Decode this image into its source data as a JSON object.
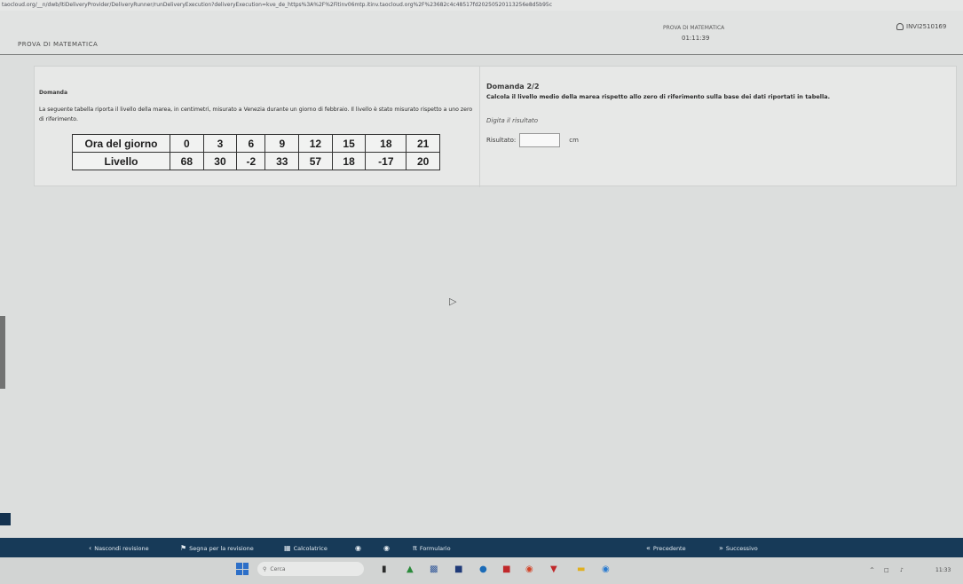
{
  "browser": {
    "url": "taocloud.org/__n/dwb/ltiDeliveryProvider/DeliveryRunner/runDeliveryExecution?deliveryExecution=kve_de_https%3A%2F%2Fitinv06mtp.itinv.taocloud.org%2F%23682c4c48517fd20250520113256e8d5b95c"
  },
  "header": {
    "app_name": "PROVA DI MATEMATICA",
    "exam_title": "PROVA DI MATEMATICA",
    "timer": "01:11:39",
    "user_id": "INVI2510169"
  },
  "question": {
    "heading": "Domanda",
    "text": "La seguente tabella riporta il livello della marea, in centimetri, misurato a Venezia durante un giorno di febbraio. Il livello è stato misurato rispetto a uno zero di riferimento.",
    "table": {
      "header_label": "Ora del giorno",
      "hours": [
        "0",
        "3",
        "6",
        "9",
        "12",
        "15",
        "18",
        "21"
      ],
      "row_label": "Livello",
      "levels": [
        "68",
        "30",
        "-2",
        "33",
        "57",
        "18",
        "-17",
        "20"
      ]
    }
  },
  "answer": {
    "heading": "Domanda 2/2",
    "prompt": "Calcola il livello medio della marea rispetto allo zero di riferimento sulla base dei dati riportati in tabella.",
    "instruction": "Digita il risultato",
    "result_label": "Risultato:",
    "input_value": "",
    "unit": "cm"
  },
  "toolbar": {
    "hide_review": "Nascondi revisione",
    "flag_review": "Segna per la revisione",
    "calculator": "Calcolatrice",
    "formulary": "Formulario",
    "previous": "Precedente",
    "next": "Successivo"
  },
  "taskbar": {
    "search_placeholder": "Cerca",
    "clock": "11:33"
  }
}
